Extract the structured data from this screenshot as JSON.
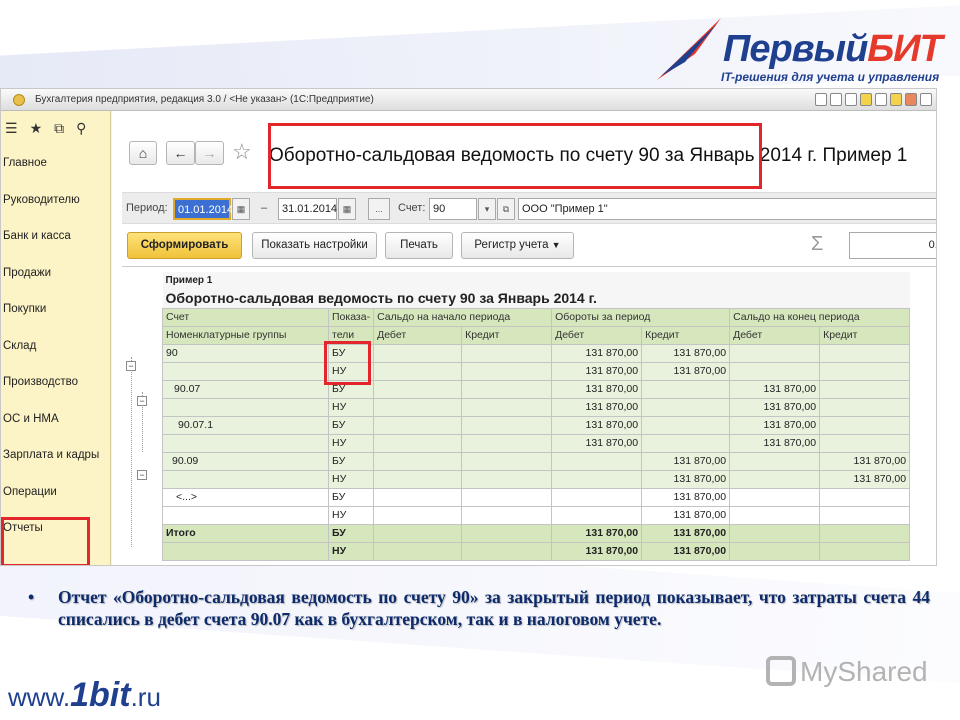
{
  "logo": {
    "title_a": "Первый",
    "title_b": "БИТ",
    "subtitle": "IT-решения для учета и управления"
  },
  "window": {
    "title": "Бухгалтерия предприятия, редакция 3.0 / <Не указан> (1С:Предприятие)"
  },
  "sidebar": {
    "items": [
      {
        "label": "Главное"
      },
      {
        "label": "Руководителю"
      },
      {
        "label": "Банк и касса"
      },
      {
        "label": "Продажи"
      },
      {
        "label": "Покупки"
      },
      {
        "label": "Склад"
      },
      {
        "label": "Производство"
      },
      {
        "label": "ОС и НМА"
      },
      {
        "label": "Зарплата и кадры"
      },
      {
        "label": "Операции"
      },
      {
        "label": "Отчеты"
      }
    ]
  },
  "report_header": {
    "title": "Оборотно-сальдовая ведомость по счету 90 за Январь 2014 г. Пример 1"
  },
  "filters": {
    "period_label": "Период:",
    "date_from": "01.01.2014",
    "dash": "–",
    "date_to": "31.01.2014",
    "ellipsis": "...",
    "account_label": "Счет:",
    "account": "90",
    "organization": "ООО \"Пример 1\""
  },
  "toolbar": {
    "generate": "Сформировать",
    "show_settings": "Показать настройки",
    "print": "Печать",
    "account_register": "Регистр учета",
    "sum_value": "0,00"
  },
  "report": {
    "org": "Пример 1",
    "title": "Оборотно-сальдовая ведомость по счету 90 за Январь 2014 г.",
    "headers": {
      "account": "Счет",
      "indicator": "Показа-",
      "indicator2": "тели",
      "opening": "Сальдо на начало периода",
      "turnover": "Обороты за период",
      "closing": "Сальдо на конец периода",
      "nomenclature": "Номенклатурные группы",
      "debit": "Дебет",
      "credit": "Кредит"
    },
    "rows": [
      {
        "name": "90",
        "ind": "БУ",
        "c1": "",
        "c2": "",
        "c3": "131 870,00",
        "c4": "131 870,00",
        "c5": "",
        "c6": ""
      },
      {
        "name": "",
        "ind": "НУ",
        "c1": "",
        "c2": "",
        "c3": "131 870,00",
        "c4": "131 870,00",
        "c5": "",
        "c6": ""
      },
      {
        "name": "90.07",
        "ind": "БУ",
        "c1": "",
        "c2": "",
        "c3": "131 870,00",
        "c4": "",
        "c5": "131 870,00",
        "c6": ""
      },
      {
        "name": "",
        "ind": "НУ",
        "c1": "",
        "c2": "",
        "c3": "131 870,00",
        "c4": "",
        "c5": "131 870,00",
        "c6": ""
      },
      {
        "name": "90.07.1",
        "ind": "БУ",
        "c1": "",
        "c2": "",
        "c3": "131 870,00",
        "c4": "",
        "c5": "131 870,00",
        "c6": ""
      },
      {
        "name": "",
        "ind": "НУ",
        "c1": "",
        "c2": "",
        "c3": "131 870,00",
        "c4": "",
        "c5": "131 870,00",
        "c6": ""
      },
      {
        "name": "90.09",
        "ind": "БУ",
        "c1": "",
        "c2": "",
        "c3": "",
        "c4": "131 870,00",
        "c5": "",
        "c6": "131 870,00"
      },
      {
        "name": "",
        "ind": "НУ",
        "c1": "",
        "c2": "",
        "c3": "",
        "c4": "131 870,00",
        "c5": "",
        "c6": "131 870,00"
      },
      {
        "name": "<...>",
        "ind": "БУ",
        "c1": "",
        "c2": "",
        "c3": "",
        "c4": "131 870,00",
        "c5": "",
        "c6": ""
      },
      {
        "name": "",
        "ind": "НУ",
        "c1": "",
        "c2": "",
        "c3": "",
        "c4": "131 870,00",
        "c5": "",
        "c6": ""
      },
      {
        "name": "Итого",
        "ind": "БУ",
        "c1": "",
        "c2": "",
        "c3": "131 870,00",
        "c4": "131 870,00",
        "c5": "",
        "c6": ""
      },
      {
        "name": "",
        "ind": "НУ",
        "c1": "",
        "c2": "",
        "c3": "131 870,00",
        "c4": "131 870,00",
        "c5": "",
        "c6": ""
      }
    ]
  },
  "caption": {
    "bullet": "•",
    "text": "Отчет «Оборотно-сальдовая ведомость по счету 90» за закрытый период показывает, что затраты счета 44 списались в дебет счета 90.07 как в бухгалтерском, так и в налоговом учете."
  },
  "footer": {
    "site_a": "www.",
    "site_b": "1bit",
    "site_c": ".ru",
    "watermark": "MyShared"
  },
  "colors": {
    "accent_red": "#e3262b",
    "sidebar_bg": "#fcf3c6",
    "header_green": "#d6e7bd",
    "primary_button": "#f0c23a",
    "brand_blue": "#1f3f8f"
  }
}
